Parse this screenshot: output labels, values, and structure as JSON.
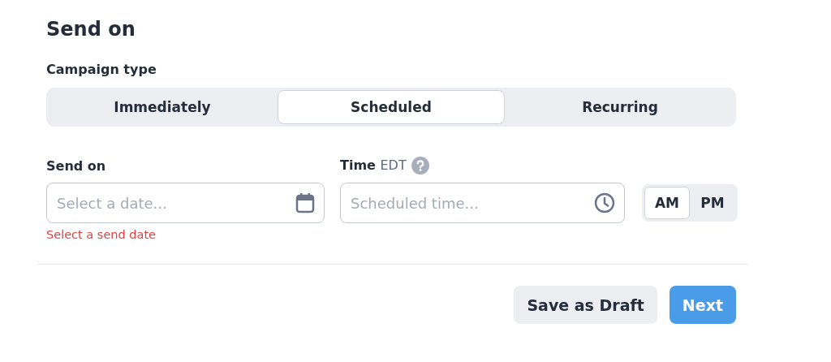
{
  "title": "Send on",
  "campaign_type": {
    "label": "Campaign type",
    "options": [
      {
        "label": "Immediately",
        "selected": false
      },
      {
        "label": "Scheduled",
        "selected": true
      },
      {
        "label": "Recurring",
        "selected": false
      }
    ]
  },
  "send_on": {
    "label": "Send on",
    "placeholder": "Select a date...",
    "error": "Select a send date"
  },
  "time": {
    "label": "Time",
    "timezone": "EDT",
    "placeholder": "Scheduled time..."
  },
  "meridiem": [
    {
      "label": "AM",
      "selected": true
    },
    {
      "label": "PM",
      "selected": false
    }
  ],
  "buttons": [
    {
      "label": "Save as Draft",
      "kind": "secondary"
    },
    {
      "label": "Next",
      "kind": "primary"
    }
  ]
}
